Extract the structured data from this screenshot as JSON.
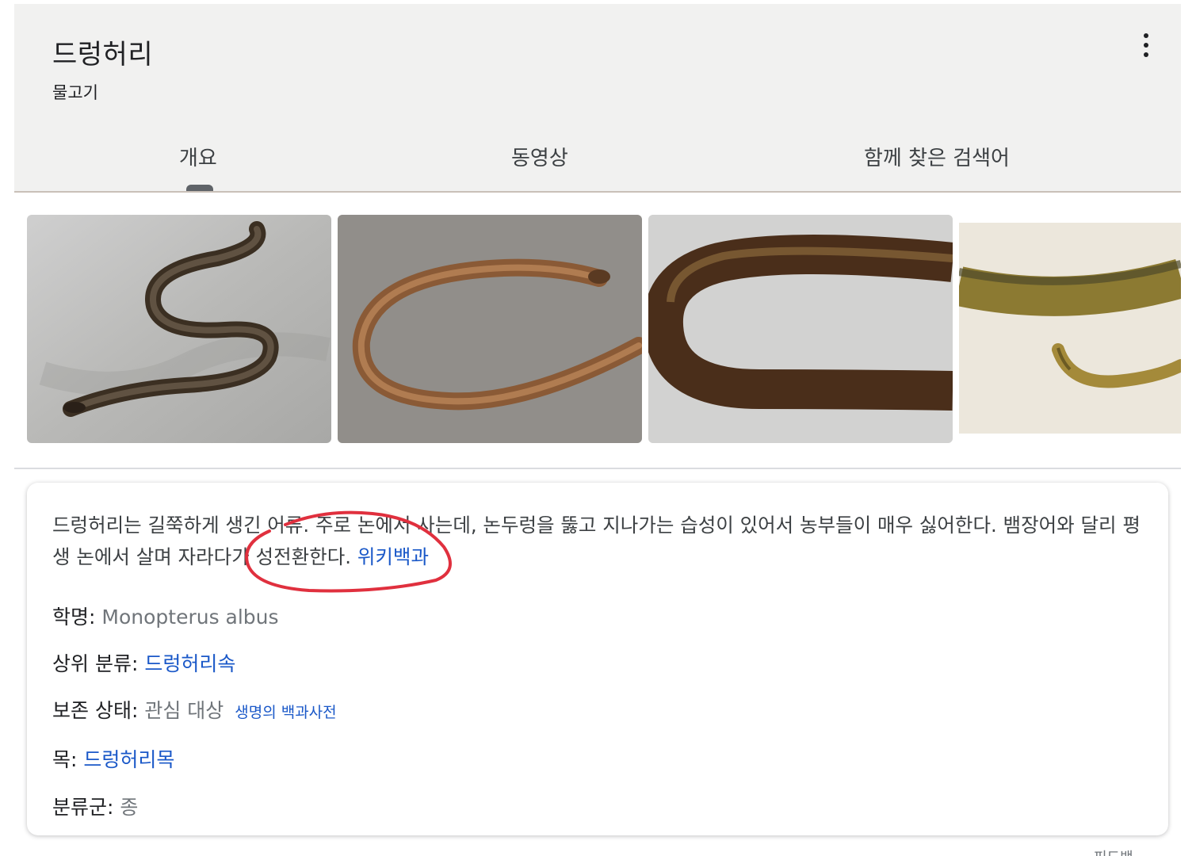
{
  "header": {
    "title": "드렁허리",
    "subtitle": "물고기"
  },
  "tabs": [
    {
      "label": "개요",
      "active": true
    },
    {
      "label": "동영상",
      "active": false
    },
    {
      "label": "함께 찾은 검색어",
      "active": false
    }
  ],
  "images": [
    {
      "subject": "eel-photo-1"
    },
    {
      "subject": "eel-photo-2"
    },
    {
      "subject": "eel-photo-3"
    },
    {
      "subject": "eel-illustration-4"
    }
  ],
  "description": {
    "text_1": "드렁허리는 길쭉하게 생긴 어류. 주로 논에서 사는데, 논두렁을 뚫고 지나가는 습성이 있어서 농부들이 매우 싫어한다. 뱀장어와 달리 평생 논에서 살며 자라다가 성전환한다.",
    "source_link": "위키백과"
  },
  "facts": [
    {
      "label": "학명:",
      "value": "Monopterus albus",
      "value_is_link": false
    },
    {
      "label": "상위 분류:",
      "value": "드렁허리속",
      "value_is_link": true
    },
    {
      "label": "보존 상태:",
      "value": "관심 대상",
      "value_is_link": false,
      "source": "생명의 백과사전"
    },
    {
      "label": "목:",
      "value": "드렁허리목",
      "value_is_link": true
    },
    {
      "label": "분류군:",
      "value": "종",
      "value_is_link": false
    }
  ],
  "colors": {
    "link": "#1a58c8",
    "annotation": "#e0303e",
    "header_bg": "#f1f1f0"
  },
  "icons": {
    "more": "vertical-dots-icon"
  },
  "footer_partial": "피드백"
}
